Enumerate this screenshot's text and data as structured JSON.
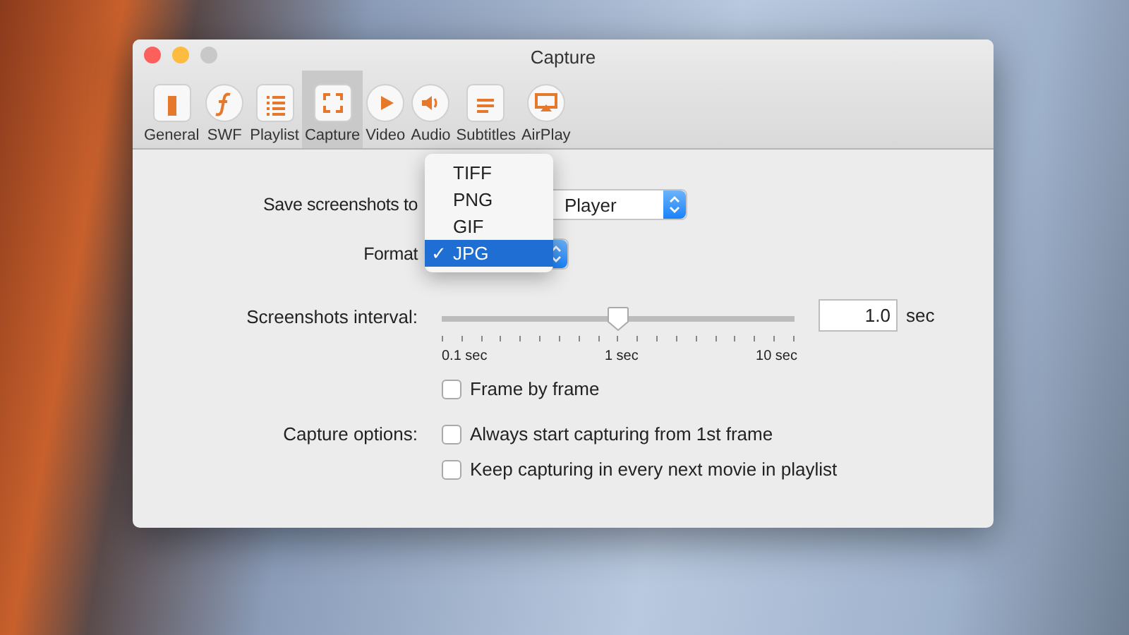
{
  "window": {
    "title": "Capture"
  },
  "toolbar": [
    {
      "label": "General",
      "selected": false
    },
    {
      "label": "SWF",
      "selected": false
    },
    {
      "label": "Playlist",
      "selected": false
    },
    {
      "label": "Capture",
      "selected": true
    },
    {
      "label": "Video",
      "selected": false
    },
    {
      "label": "Audio",
      "selected": false
    },
    {
      "label": "Subtitles",
      "selected": false
    },
    {
      "label": "AirPlay",
      "selected": false
    }
  ],
  "save_to": {
    "label": "Save screenshots to",
    "value": "Player"
  },
  "format": {
    "label": "Format",
    "menu": [
      {
        "label": "TIFF",
        "selected": false
      },
      {
        "label": "PNG",
        "selected": false
      },
      {
        "label": "GIF",
        "selected": false
      },
      {
        "label": "JPG",
        "selected": true
      }
    ],
    "check": "✓"
  },
  "interval": {
    "label": "Screenshots interval:",
    "level": 0.5,
    "value": "1.0",
    "unit": "sec",
    "ticks": [
      "0.1 sec",
      "1 sec",
      "10 sec"
    ]
  },
  "frame_by_frame": {
    "label": "Frame by frame",
    "checked": false
  },
  "capture_options": {
    "label": "Capture options:",
    "options": [
      {
        "label": "Always start capturing from 1st frame",
        "checked": false
      },
      {
        "label": "Keep capturing in every next movie in playlist",
        "checked": false
      }
    ]
  }
}
